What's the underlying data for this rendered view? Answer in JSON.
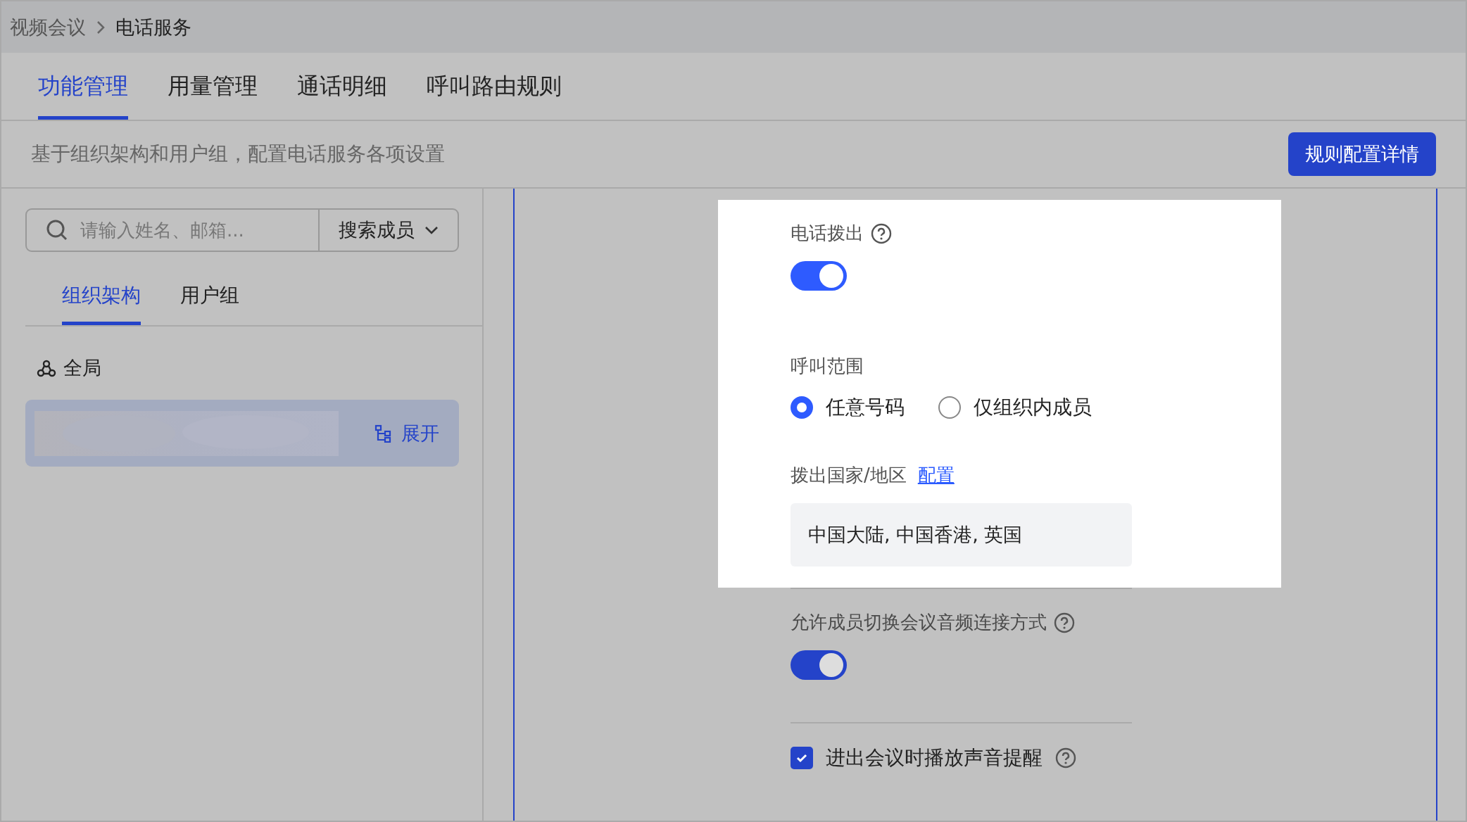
{
  "breadcrumb": [
    {
      "label": "视频会议"
    },
    {
      "label": "电话服务"
    }
  ],
  "tabs": [
    {
      "label": "功能管理",
      "selected": true
    },
    {
      "label": "用量管理",
      "selected": false
    },
    {
      "label": "通话明细",
      "selected": false
    },
    {
      "label": "呼叫路由规则",
      "selected": false
    }
  ],
  "description": "基于组织架构和用户组，配置电话服务各项设置",
  "primary_button": "规则配置详情",
  "search": {
    "placeholder": "请输入姓名、邮箱...",
    "scope": "搜索成员"
  },
  "sub_tabs": [
    {
      "label": "组织架构",
      "selected": true
    },
    {
      "label": "用户组",
      "selected": false
    }
  ],
  "tree": {
    "root": "全局",
    "item": {
      "action": "展开",
      "selected": true
    }
  },
  "settings": [
    {
      "kind": "toggle",
      "label": "电话拨出",
      "help": true,
      "on": true,
      "highlighted": true
    },
    {
      "kind": "radio",
      "label": "呼叫范围",
      "highlighted": true,
      "options": [
        {
          "label": "任意号码",
          "selected": true
        },
        {
          "label": "仅组织内成员",
          "selected": false
        }
      ]
    },
    {
      "kind": "field",
      "label": "拨出国家/地区",
      "link": "配置",
      "value": "中国大陆, 中国香港, 英国",
      "highlighted": true
    },
    {
      "kind": "divider"
    },
    {
      "kind": "toggle",
      "label": "允许成员切换会议音频连接方式",
      "help": true,
      "on": true,
      "highlighted": false
    },
    {
      "kind": "divider"
    },
    {
      "kind": "checkbox",
      "label": "进出会议时播放声音提醒",
      "help": true,
      "checked": true,
      "highlighted": false
    }
  ]
}
